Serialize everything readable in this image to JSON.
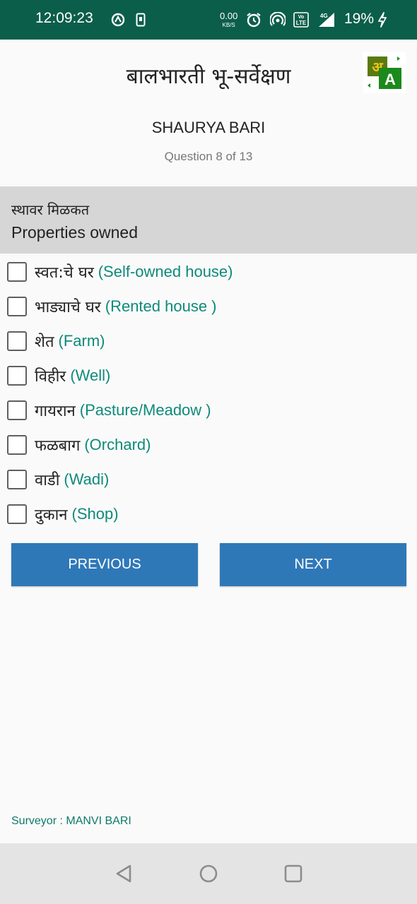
{
  "status_bar": {
    "time": "12:09:23",
    "net_speed_value": "0.00",
    "net_speed_unit": "KB/S",
    "battery_percent": "19%",
    "network_type": "4G",
    "volte": "LTE",
    "icons": [
      "sync-icon",
      "phone-icon",
      "alarm-icon",
      "hotspot-icon",
      "volte-icon",
      "signal-icon",
      "charging-icon"
    ]
  },
  "app": {
    "title": "बालभारती भू-सर्वेक्षण",
    "translate_icon_letters": [
      "अ",
      "A"
    ]
  },
  "respondent_name": "SHAURYA BARI",
  "progress_text": "Question 8 of 13",
  "question": {
    "marathi": "स्थावर मिळकत",
    "english": "Properties owned"
  },
  "options": [
    {
      "marathi": "स्वत:चे घर",
      "english": "(Self-owned house)",
      "checked": false
    },
    {
      "marathi": "भाड्याचे घर",
      "english": "(Rented house )",
      "checked": false
    },
    {
      "marathi": "शेत",
      "english": "(Farm)",
      "checked": false
    },
    {
      "marathi": "विहीर",
      "english": "(Well)",
      "checked": false
    },
    {
      "marathi": "गायरान",
      "english": "(Pasture/Meadow )",
      "checked": false
    },
    {
      "marathi": "फळबाग",
      "english": "(Orchard)",
      "checked": false
    },
    {
      "marathi": "वाडी",
      "english": "(Wadi)",
      "checked": false
    },
    {
      "marathi": "दुकान",
      "english": "(Shop)",
      "checked": false
    }
  ],
  "buttons": {
    "previous": "PREVIOUS",
    "next": "NEXT"
  },
  "footer": {
    "surveyor": "Surveyor : MANVI BARI"
  },
  "nav": {
    "icons": [
      "back-icon",
      "home-icon",
      "recents-icon"
    ]
  },
  "colors": {
    "status_bar": "#0b5e4a",
    "question_bg": "#d6d6d6",
    "option_english": "#0e8a7a",
    "button": "#2f78b8",
    "surveyor": "#0e7a6a"
  }
}
